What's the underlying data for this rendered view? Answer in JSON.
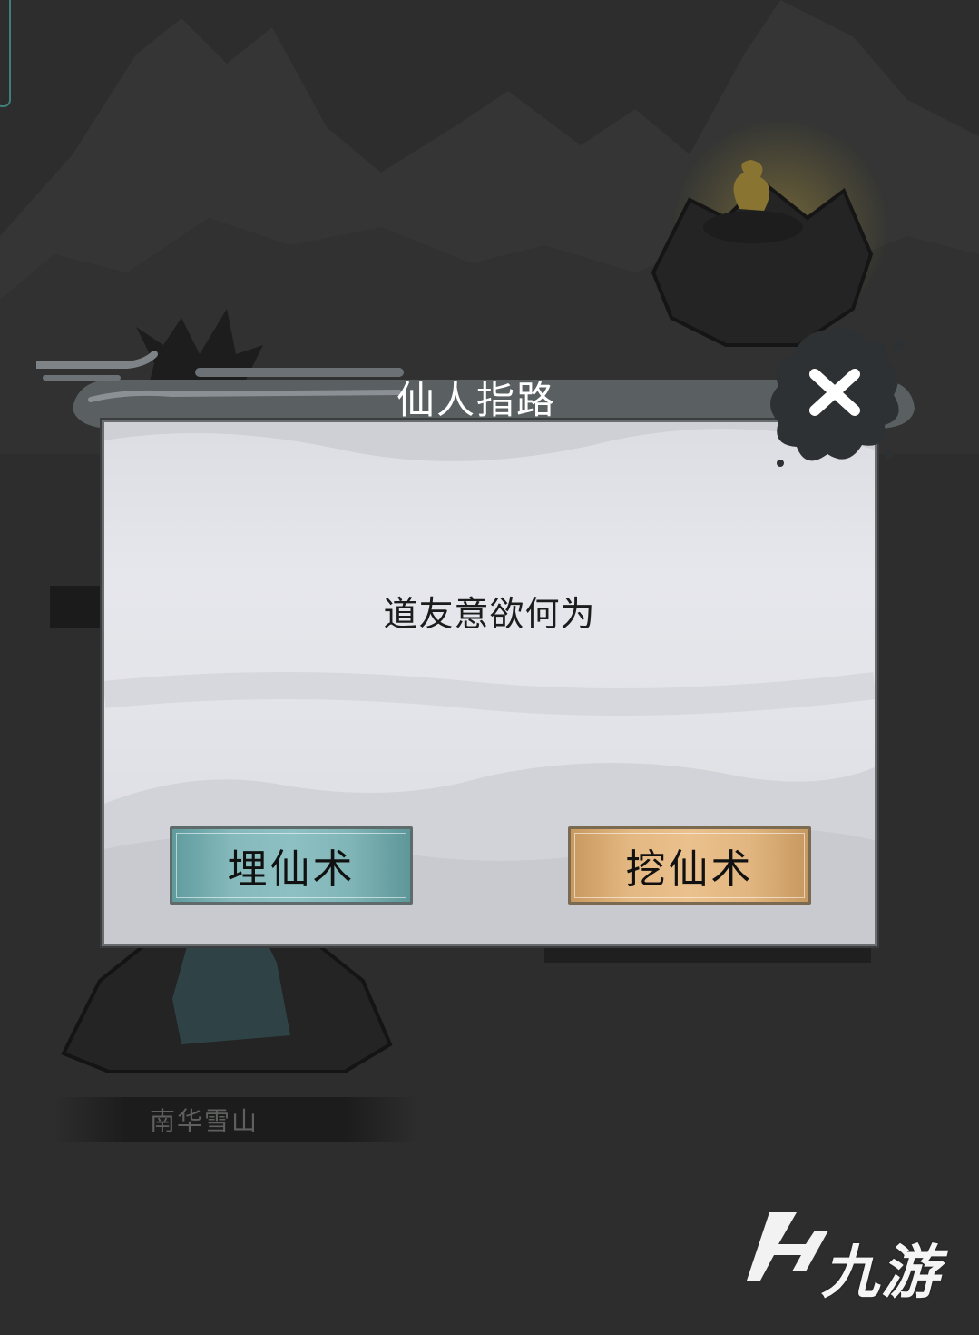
{
  "map": {
    "location_label": "南华雪山"
  },
  "dialog": {
    "title": "仙人指路",
    "message": "道友意欲何为",
    "bury_button": "埋仙术",
    "dig_button": "挖仙术",
    "close_icon": "close-x-icon"
  },
  "watermark": {
    "text": "九游",
    "icon": "jiuyou-logo-icon"
  },
  "colors": {
    "background": "#2b2c2b",
    "panel": "#e2e3e8",
    "bury_button": "#85b9bb",
    "dig_button": "#e4b882",
    "frame_accent": "#3f7f79"
  }
}
